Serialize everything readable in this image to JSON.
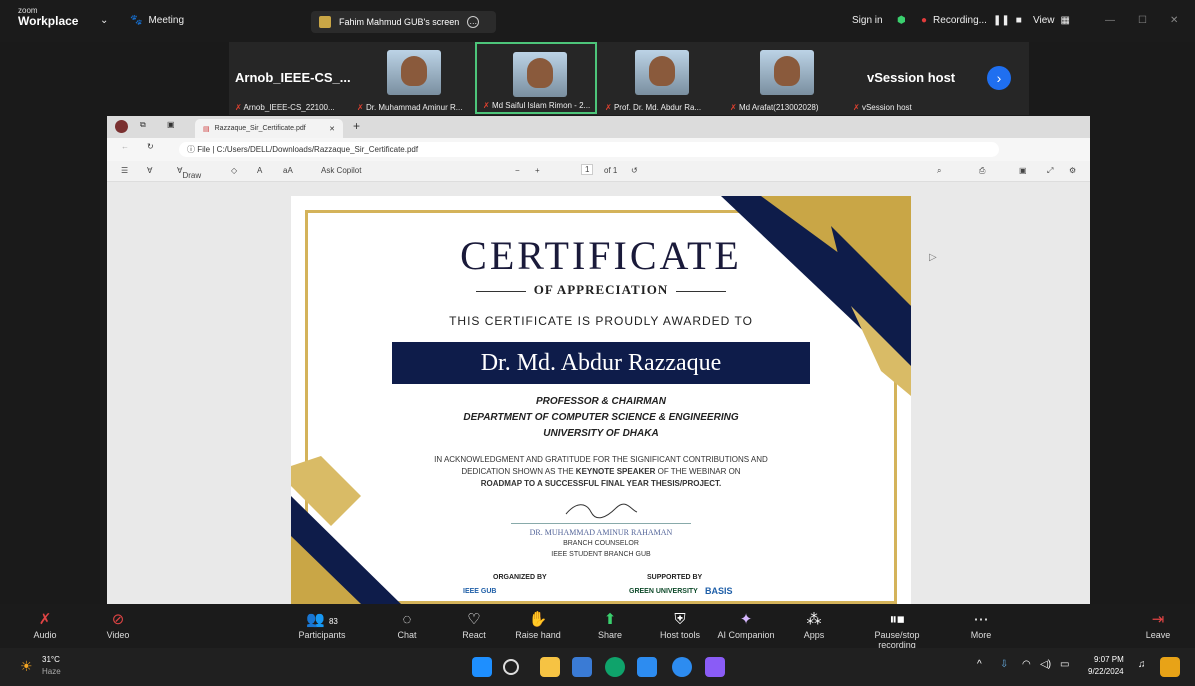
{
  "topbar": {
    "logo_small": "zoom",
    "logo_big": "Workplace",
    "meeting_label": "Meeting",
    "screen_label": "Fahim Mahmud GUB's screen",
    "sign_in": "Sign in",
    "recording": "Recording...",
    "view": "View"
  },
  "participants_strip": {
    "left_name": "Arnob_IEEE-CS_...",
    "right_name": "vSession host",
    "tiles": [
      {
        "label": "Arnob_IEEE-CS_22100..."
      },
      {
        "label": "Dr. Muhammad Aminur R..."
      },
      {
        "label": "Md Saiful Islam Rimon - 2..."
      },
      {
        "label": "Prof. Dr. Md. Abdur Ra..."
      },
      {
        "label": "Md Arafat(213002028)"
      },
      {
        "label": "vSession host"
      }
    ]
  },
  "browser": {
    "tab_title": "Razzaque_Sir_Certificate.pdf",
    "url_prefix": "File",
    "url": "C:/Users/DELL/Downloads/Razzaque_Sir_Certificate.pdf",
    "draw": "Draw",
    "ask_copilot": "Ask Copilot",
    "page_num": "1",
    "page_of": "of 1"
  },
  "certificate": {
    "title": "CERTIFICATE",
    "subtitle": "OF APPRECIATION",
    "awarded": "THIS CERTIFICATE IS PROUDLY AWARDED TO",
    "name": "Dr. Md. Abdur Razzaque",
    "role1": "PROFESSOR & CHAIRMAN",
    "role2": "DEPARTMENT OF COMPUTER SCIENCE & ENGINEERING",
    "role3": "UNIVERSITY OF DHAKA",
    "ack1": "IN ACKNOWLEDGMENT AND GRATITUDE FOR THE SIGNIFICANT CONTRIBUTIONS AND",
    "ack2_a": "DEDICATION SHOWN AS THE ",
    "ack2_b": "KEYNOTE SPEAKER",
    "ack2_c": " OF THE WEBINAR ON",
    "ack3": "ROADMAP TO A SUCCESSFUL FINAL YEAR THESIS/PROJECT.",
    "signer": "DR. MUHAMMAD AMINUR RAHAMAN",
    "signer_role1": "BRANCH COUNSELOR",
    "signer_role2": "IEEE STUDENT BRANCH GUB",
    "organized_by": "ORGANIZED BY",
    "supported_by": "SUPPORTED BY",
    "org_logo": "IEEE GUB",
    "sup_logo1": "GREEN UNIVERSITY",
    "sup_logo2": "BASIS"
  },
  "controls": [
    {
      "label": "Audio",
      "icon": "mic-muted-icon"
    },
    {
      "label": "Video",
      "icon": "video-off-icon"
    },
    {
      "label": "Participants",
      "icon": "participants-icon",
      "count": "83"
    },
    {
      "label": "Chat",
      "icon": "chat-icon"
    },
    {
      "label": "React",
      "icon": "heart-icon"
    },
    {
      "label": "Raise hand",
      "icon": "hand-icon"
    },
    {
      "label": "Share",
      "icon": "share-icon"
    },
    {
      "label": "Host tools",
      "icon": "shield-icon"
    },
    {
      "label": "AI Companion",
      "icon": "sparkle-icon"
    },
    {
      "label": "Apps",
      "icon": "apps-icon"
    },
    {
      "label": "Pause/stop recording",
      "icon": "pause-stop-icon"
    },
    {
      "label": "More",
      "icon": "more-icon"
    },
    {
      "label": "Leave",
      "icon": "leave-icon"
    }
  ],
  "taskbar": {
    "temp": "31°C",
    "weather": "Haze",
    "time": "9:07 PM",
    "date": "9/22/2024"
  },
  "colors": {
    "navy": "#0e1c4a",
    "gold": "#c9a646",
    "zoom_blue": "#1f6ff0",
    "active_green": "#4dc57a"
  }
}
